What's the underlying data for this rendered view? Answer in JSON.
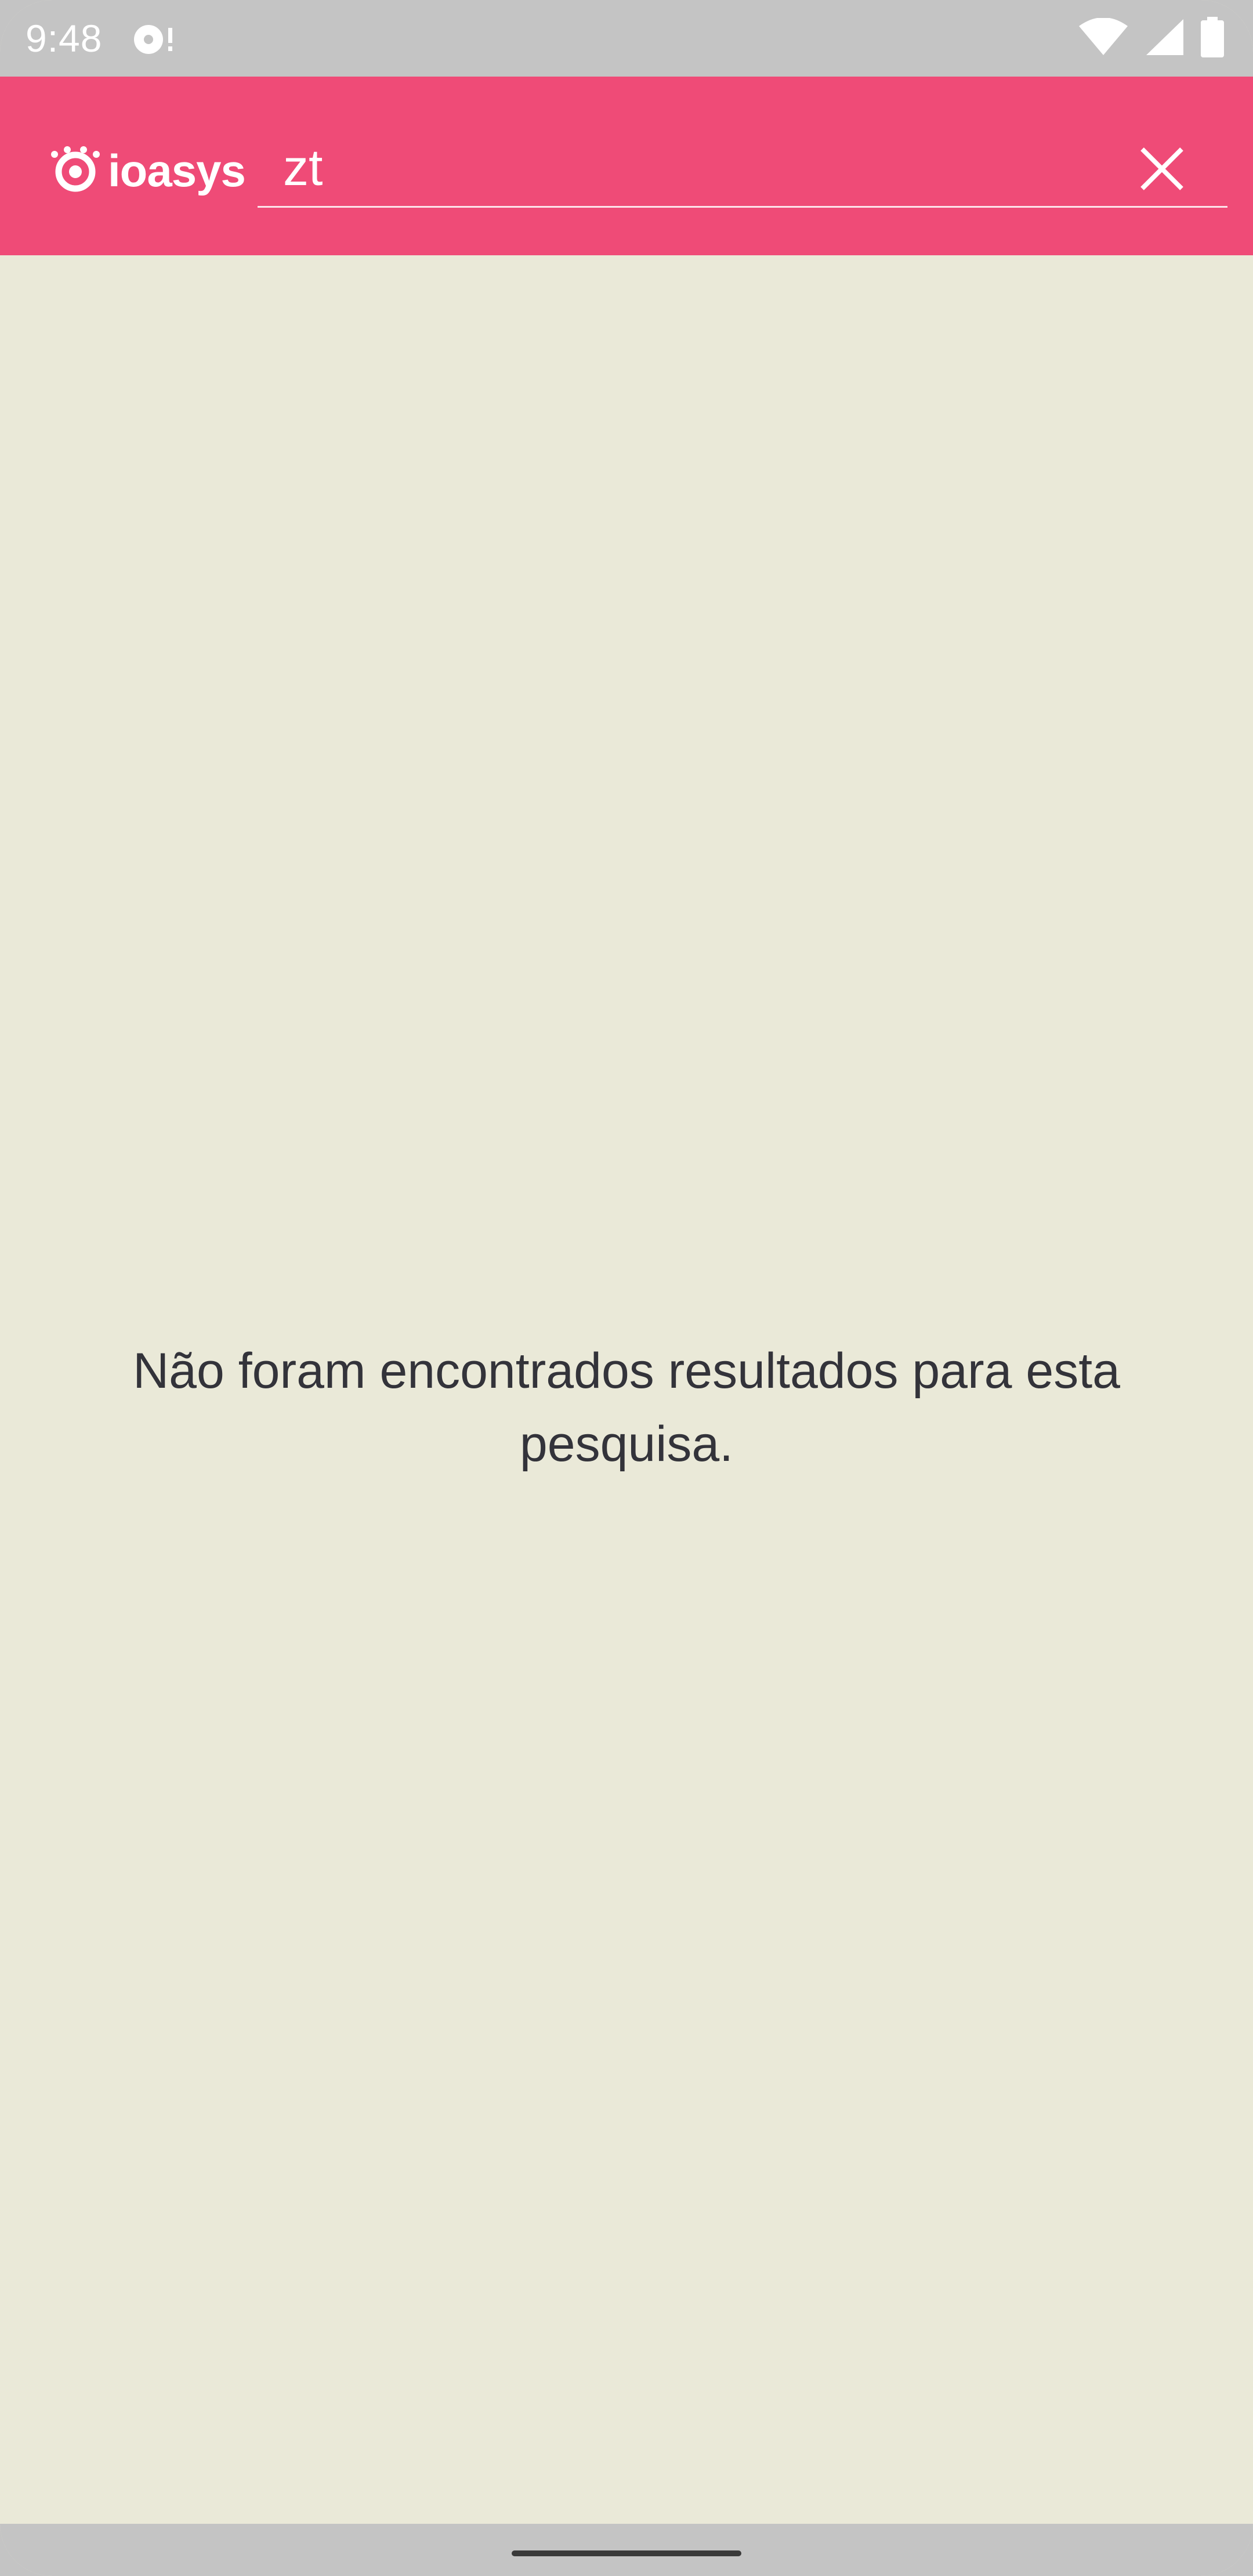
{
  "status_bar": {
    "time": "9:48",
    "icons": [
      "notification-icon",
      "wifi-icon",
      "cellular-signal-icon",
      "battery-icon"
    ]
  },
  "app_bar": {
    "logo_text": "ioasys",
    "search": {
      "value": "zt"
    },
    "close_icon": "close-icon",
    "background_color": "#ef4b77"
  },
  "main": {
    "empty_message": "Não foram encontrados resultados para esta pesquisa.",
    "background_color": "#eae9d8"
  }
}
